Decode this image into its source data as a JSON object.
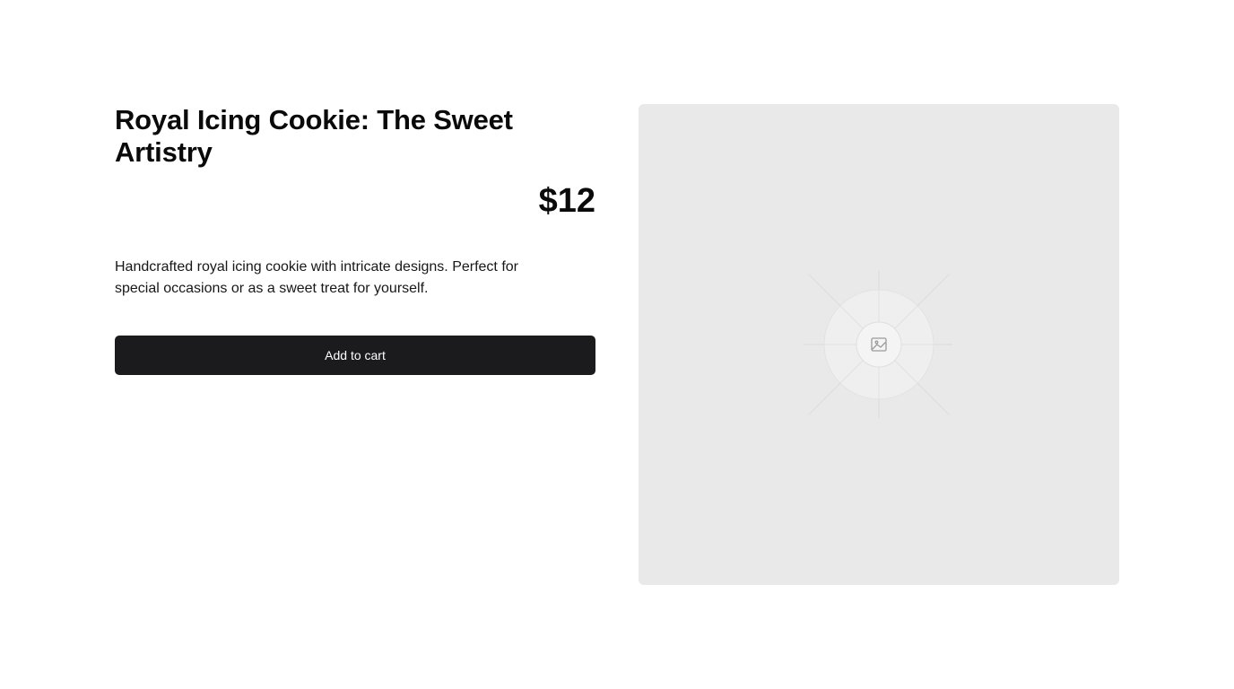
{
  "product": {
    "title": "Royal Icing Cookie: The Sweet Artistry",
    "price": "$12",
    "description": "Handcrafted royal icing cookie with intricate designs. Perfect for special occasions or as a sweet treat for yourself.",
    "add_to_cart_label": "Add to cart"
  },
  "image": {
    "icon": "image-placeholder-icon"
  },
  "colors": {
    "button_bg": "#1b1b1d",
    "image_bg": "#e9e9e9"
  }
}
